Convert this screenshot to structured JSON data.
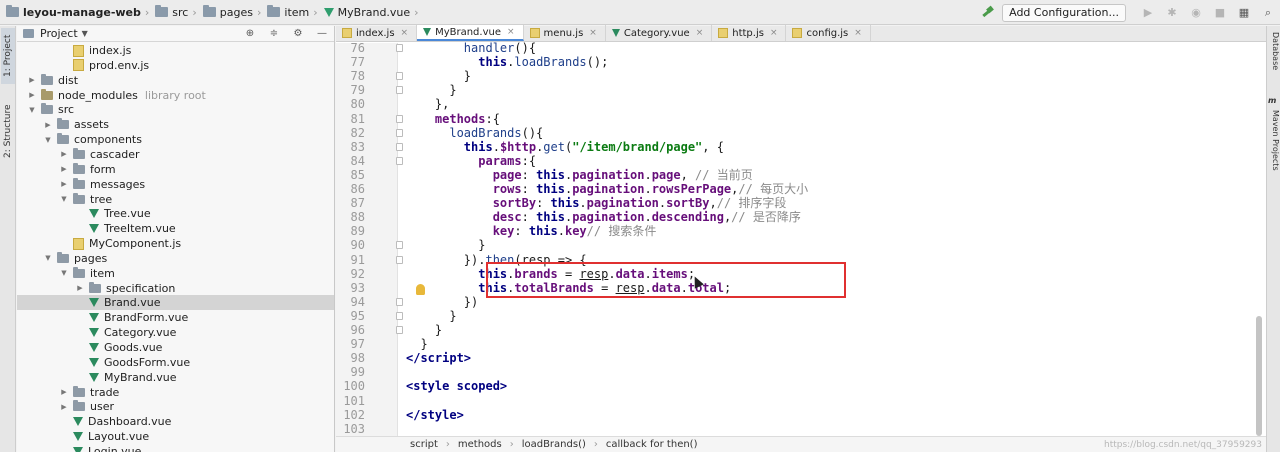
{
  "breadcrumb": [
    "leyou-manage-web",
    "src",
    "pages",
    "item",
    "MyBrand.vue"
  ],
  "toolbar": {
    "add_configuration": "Add Configuration..."
  },
  "left_strip": [
    "1: Project",
    "2: Structure"
  ],
  "right_strip": [
    "Database",
    "m",
    "Maven Projects"
  ],
  "project_panel": {
    "title": "Project",
    "tree": [
      {
        "name": "index.js",
        "type": "js",
        "indent": 3,
        "arrow": "none"
      },
      {
        "name": "prod.env.js",
        "type": "js",
        "indent": 3,
        "arrow": "none"
      },
      {
        "name": "dist",
        "type": "folder",
        "indent": 1,
        "arrow": "closed"
      },
      {
        "name": "node_modules",
        "type": "folder-nm",
        "indent": 1,
        "arrow": "closed",
        "note": "library root"
      },
      {
        "name": "src",
        "type": "folder",
        "indent": 1,
        "arrow": "open"
      },
      {
        "name": "assets",
        "type": "folder",
        "indent": 2,
        "arrow": "closed"
      },
      {
        "name": "components",
        "type": "folder",
        "indent": 2,
        "arrow": "open"
      },
      {
        "name": "cascader",
        "type": "folder",
        "indent": 3,
        "arrow": "closed"
      },
      {
        "name": "form",
        "type": "folder",
        "indent": 3,
        "arrow": "closed"
      },
      {
        "name": "messages",
        "type": "folder",
        "indent": 3,
        "arrow": "closed"
      },
      {
        "name": "tree",
        "type": "folder",
        "indent": 3,
        "arrow": "open"
      },
      {
        "name": "Tree.vue",
        "type": "vue",
        "indent": 4,
        "arrow": "none"
      },
      {
        "name": "TreeItem.vue",
        "type": "vue",
        "indent": 4,
        "arrow": "none"
      },
      {
        "name": "MyComponent.js",
        "type": "js",
        "indent": 3,
        "arrow": "none"
      },
      {
        "name": "pages",
        "type": "folder",
        "indent": 2,
        "arrow": "open"
      },
      {
        "name": "item",
        "type": "folder",
        "indent": 3,
        "arrow": "open"
      },
      {
        "name": "specification",
        "type": "folder",
        "indent": 4,
        "arrow": "closed"
      },
      {
        "name": "Brand.vue",
        "type": "vue",
        "indent": 4,
        "arrow": "none",
        "selected": true
      },
      {
        "name": "BrandForm.vue",
        "type": "vue",
        "indent": 4,
        "arrow": "none"
      },
      {
        "name": "Category.vue",
        "type": "vue",
        "indent": 4,
        "arrow": "none"
      },
      {
        "name": "Goods.vue",
        "type": "vue",
        "indent": 4,
        "arrow": "none"
      },
      {
        "name": "GoodsForm.vue",
        "type": "vue",
        "indent": 4,
        "arrow": "none"
      },
      {
        "name": "MyBrand.vue",
        "type": "vue",
        "indent": 4,
        "arrow": "none"
      },
      {
        "name": "trade",
        "type": "folder",
        "indent": 3,
        "arrow": "closed"
      },
      {
        "name": "user",
        "type": "folder",
        "indent": 3,
        "arrow": "closed"
      },
      {
        "name": "Dashboard.vue",
        "type": "vue",
        "indent": 3,
        "arrow": "none"
      },
      {
        "name": "Layout.vue",
        "type": "vue",
        "indent": 3,
        "arrow": "none"
      },
      {
        "name": "Login.vue",
        "type": "vue",
        "indent": 3,
        "arrow": "none"
      }
    ]
  },
  "tabs": [
    {
      "label": "index.js",
      "type": "js",
      "active": false
    },
    {
      "label": "MyBrand.vue",
      "type": "vue",
      "active": true
    },
    {
      "label": "menu.js",
      "type": "js",
      "active": false
    },
    {
      "label": "Category.vue",
      "type": "vue",
      "active": false
    },
    {
      "label": "http.js",
      "type": "js",
      "active": false
    },
    {
      "label": "config.js",
      "type": "js",
      "active": false
    }
  ],
  "code_lines": [
    {
      "n": "76",
      "html": "        <span class=\"fn\">handler</span>(){"
    },
    {
      "n": "77",
      "html": "          <span class=\"kw\">this</span>.<span class=\"fn\">loadBrands</span>();"
    },
    {
      "n": "78",
      "html": "        }"
    },
    {
      "n": "79",
      "html": "      }"
    },
    {
      "n": "80",
      "html": "    },"
    },
    {
      "n": "81",
      "html": "    <span class=\"prop\">methods</span>:{"
    },
    {
      "n": "82",
      "html": "      <span class=\"fn\">loadBrands</span>(){"
    },
    {
      "n": "83",
      "html": "        <span class=\"kw\">this</span>.<span class=\"prop\">$http</span>.<span class=\"fn\">get</span>(<span class=\"str\">\"/item/brand/page\"</span>, {"
    },
    {
      "n": "84",
      "html": "          <span class=\"prop\">params</span>:{"
    },
    {
      "n": "85",
      "html": "            <span class=\"prop\">page</span>: <span class=\"kw\">this</span>.<span class=\"prop\">pagination</span>.<span class=\"prop\">page</span>, <span class=\"cmt\">// 当前页</span>"
    },
    {
      "n": "86",
      "html": "            <span class=\"prop\">rows</span>: <span class=\"kw\">this</span>.<span class=\"prop\">pagination</span>.<span class=\"prop\">rowsPerPage</span>,<span class=\"cmt\">// 每页大小</span>"
    },
    {
      "n": "87",
      "html": "            <span class=\"prop\">sortBy</span>: <span class=\"kw\">this</span>.<span class=\"prop\">pagination</span>.<span class=\"prop\">sortBy</span>,<span class=\"cmt\">// 排序字段</span>"
    },
    {
      "n": "88",
      "html": "            <span class=\"prop\">desc</span>: <span class=\"kw\">this</span>.<span class=\"prop\">pagination</span>.<span class=\"prop\">descending</span>,<span class=\"cmt\">// 是否降序</span>"
    },
    {
      "n": "89",
      "html": "            <span class=\"prop\">key</span>: <span class=\"kw\">this</span>.<span class=\"prop\">key</span><span class=\"cmt\">// 搜索条件</span>"
    },
    {
      "n": "90",
      "html": "          }"
    },
    {
      "n": "91",
      "html": "        }).<span class=\"fn\">then</span>(resp => {"
    },
    {
      "n": "92",
      "html": "          <span class=\"kw\">this</span>.<span class=\"prop\">brands</span> = <span class=\"under\">resp</span>.<span class=\"prop\">data</span>.<span class=\"prop\">items</span>;"
    },
    {
      "n": "93",
      "html": "          <span class=\"kw\">this</span>.<span class=\"prop\">totalBrands</span> = <span class=\"under\">resp</span>.<span class=\"prop\">data</span>.<span class=\"prop\">total</span>;"
    },
    {
      "n": "94",
      "html": "        })"
    },
    {
      "n": "95",
      "html": "      }"
    },
    {
      "n": "96",
      "html": "    }"
    },
    {
      "n": "97",
      "html": "  }"
    },
    {
      "n": "98",
      "html": "<span class=\"tag\">&lt;/script&gt;</span>"
    },
    {
      "n": "99",
      "html": ""
    },
    {
      "n": "100",
      "html": "<span class=\"tag\">&lt;style scoped&gt;</span>"
    },
    {
      "n": "101",
      "html": ""
    },
    {
      "n": "102",
      "html": "<span class=\"tag\">&lt;/style&gt;</span>"
    },
    {
      "n": "103",
      "html": ""
    }
  ],
  "editor_breadcrumb": [
    "script",
    "methods",
    "loadBrands()",
    "callback for then()"
  ],
  "watermark": "https://blog.csdn.net/qq_37959293"
}
